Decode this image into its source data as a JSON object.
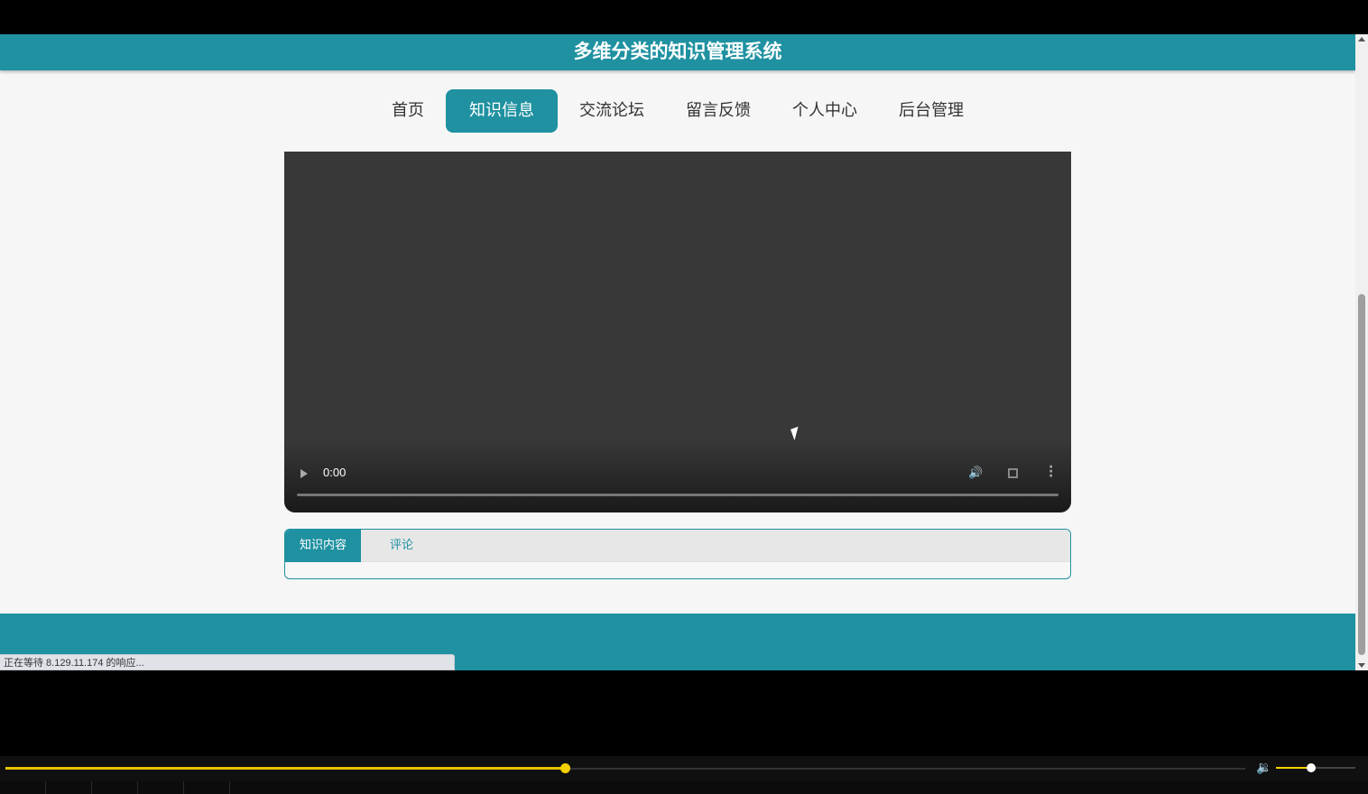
{
  "header": {
    "title": "多维分类的知识管理系统"
  },
  "nav": {
    "items": [
      {
        "label": "首页"
      },
      {
        "label": "知识信息",
        "active": true
      },
      {
        "label": "交流论坛"
      },
      {
        "label": "留言反馈"
      },
      {
        "label": "个人中心"
      },
      {
        "label": "后台管理"
      }
    ]
  },
  "video": {
    "time": "0:00",
    "progress": 0
  },
  "tabs": {
    "items": [
      {
        "label": "知识内容",
        "active": true
      },
      {
        "label": "评论"
      }
    ]
  },
  "status_bar": {
    "text": "正在等待 8.129.11.174 的响应..."
  },
  "outer_player": {
    "progress": 0.45,
    "volume": 0.45
  },
  "colors": {
    "accent": "#1f91a1",
    "seek_accent": "#f5d000"
  }
}
